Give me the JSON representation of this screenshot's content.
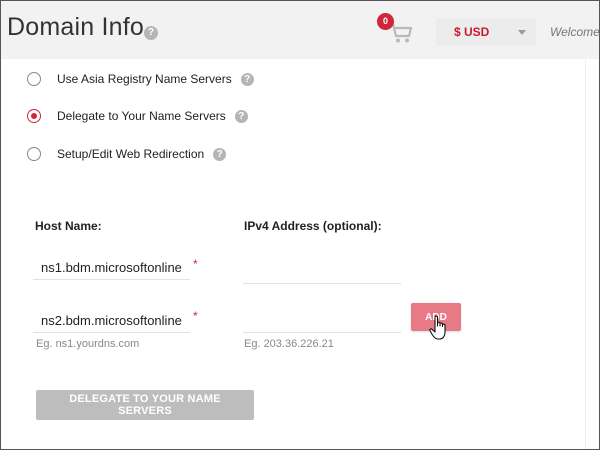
{
  "header": {
    "title": "Domain Info",
    "help_glyph": "?",
    "cart": {
      "count": "0",
      "icon": "cart-icon"
    },
    "currency": {
      "label": "$ USD"
    },
    "welcome": "Welcome",
    "welcome_accent": "l"
  },
  "radios": [
    {
      "label": "Use Asia Registry Name Servers",
      "checked": false
    },
    {
      "label": "Delegate to Your Name Servers",
      "checked": true
    },
    {
      "label": "Setup/Edit Web Redirection",
      "checked": false
    }
  ],
  "form": {
    "host_header": "Host Name:",
    "ip_header": "IPv4 Address (optional):",
    "host1": "ns1.bdm.microsoftonline",
    "host2": "ns2.bdm.microsoftonline",
    "ip1": "",
    "ip2": "",
    "required_mark": "*",
    "host_hint": "Eg. ns1.yourdns.com",
    "ip_hint": "Eg. 203.36.226.21",
    "add_label": "ADD",
    "delegate_label": "DELEGATE TO YOUR NAME SERVERS"
  },
  "colors": {
    "accent": "#d0263b",
    "add_button": "#e87a86",
    "disabled_button": "#bdbdbd"
  }
}
